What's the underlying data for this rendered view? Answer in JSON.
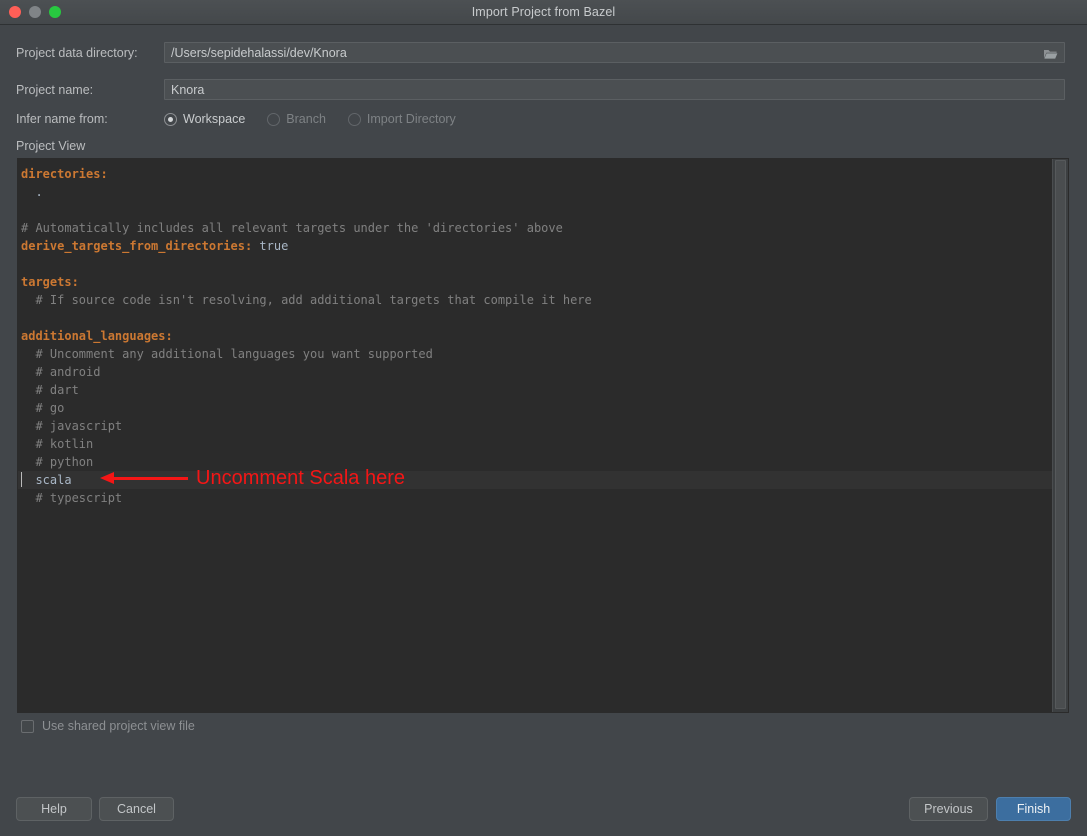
{
  "window": {
    "title": "Import Project from Bazel",
    "traffic_lights": [
      "close-light",
      "minimize-light",
      "zoom-light"
    ]
  },
  "form": {
    "path_label": "Project data directory:",
    "path_value": "/Users/sepidehalassi/dev/Knora",
    "path_placeholder": "",
    "browse_icon": "folder-icon",
    "name_label": "Project name:",
    "name_value": "Knora",
    "name_placeholder": "",
    "infer_label": "Infer name from:",
    "infer_options": [
      {
        "label": "Workspace",
        "checked": true,
        "disabled": false
      },
      {
        "label": "Branch",
        "checked": false,
        "disabled": true
      },
      {
        "label": "Import Directory",
        "checked": false,
        "disabled": true
      }
    ]
  },
  "project_view": {
    "label": "Project View",
    "lines": [
      {
        "text": "directories:",
        "kind": "key",
        "current": false
      },
      {
        "text": "  .",
        "kind": "plain",
        "current": false
      },
      {
        "text": "",
        "kind": "plain",
        "current": false
      },
      {
        "text": "# Automatically includes all relevant targets under the 'directories' above",
        "kind": "comment",
        "current": false
      },
      {
        "text": "derive_targets_from_directories: true",
        "kind": "key-value",
        "current": false
      },
      {
        "text": "",
        "kind": "plain",
        "current": false
      },
      {
        "text": "targets:",
        "kind": "key",
        "current": false
      },
      {
        "text": "  # If source code isn't resolving, add additional targets that compile it here",
        "kind": "comment",
        "current": false
      },
      {
        "text": "",
        "kind": "plain",
        "current": false
      },
      {
        "text": "additional_languages:",
        "kind": "key",
        "current": false
      },
      {
        "text": "  # Uncomment any additional languages you want supported",
        "kind": "comment",
        "current": false
      },
      {
        "text": "  # android",
        "kind": "comment",
        "current": false
      },
      {
        "text": "  # dart",
        "kind": "comment",
        "current": false
      },
      {
        "text": "  # go",
        "kind": "comment",
        "current": false
      },
      {
        "text": "  # javascript",
        "kind": "comment",
        "current": false
      },
      {
        "text": "  # kotlin",
        "kind": "comment",
        "current": false
      },
      {
        "text": "  # python",
        "kind": "comment",
        "current": false
      },
      {
        "text": "  scala",
        "kind": "plain",
        "current": true
      },
      {
        "text": "  # typescript",
        "kind": "comment",
        "current": false
      }
    ]
  },
  "annotation": {
    "text": "Uncomment Scala here",
    "color": "#f41616",
    "arrow_direction": "left"
  },
  "shared_checkbox": {
    "label": "Use shared project view file",
    "checked": false
  },
  "buttons": {
    "help": "Help",
    "cancel": "Cancel",
    "previous": "Previous",
    "finish": "Finish"
  },
  "colors": {
    "dialog_bg": "#42464a",
    "editor_bg": "#2b2b2b",
    "accent": "#3c6e9f",
    "key_token": "#cc7832",
    "comment_token": "#808080",
    "text_token": "#a9b7c6"
  }
}
